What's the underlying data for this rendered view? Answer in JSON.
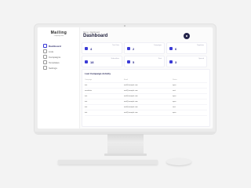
{
  "app": {
    "logo_main": "Mailing",
    "logo_sub": "campaign tool"
  },
  "sidebar": {
    "items": [
      {
        "label": "Dashboard",
        "active": true
      },
      {
        "label": "Lists",
        "active": false
      },
      {
        "label": "Campaigns",
        "active": false
      },
      {
        "label": "Templates",
        "active": false
      },
      {
        "label": "Settings",
        "active": false
      }
    ]
  },
  "header": {
    "breadcrumb": "Home / Dashboard",
    "title": "Dashboard"
  },
  "stats": [
    {
      "label": "Total Lists",
      "value": "4"
    },
    {
      "label": "Campaigns",
      "value": "2"
    },
    {
      "label": "Templates",
      "value": "6"
    },
    {
      "label": "Subscribers",
      "value": "18"
    },
    {
      "label": "Sent",
      "value": "5"
    },
    {
      "label": "Opened",
      "value": "3"
    }
  ],
  "table": {
    "title": "Last Campaign Activity",
    "headers": [
      "Campaign",
      "Email",
      "Status"
    ],
    "rows": [
      [
        "test",
        "mail@example.com",
        "open"
      ],
      [
        "newsletter",
        "mail@example.com",
        "sent"
      ],
      [
        "test",
        "mail@example.com",
        "open"
      ],
      [
        "test",
        "mail@example.com",
        "open"
      ],
      [
        "test",
        "mail@example.com",
        "sent"
      ],
      [
        "test",
        "mail@example.com",
        "open"
      ]
    ]
  },
  "colors": {
    "accent": "#3a3ad6",
    "title": "#1e1e3a",
    "avatar": "#24244a"
  }
}
